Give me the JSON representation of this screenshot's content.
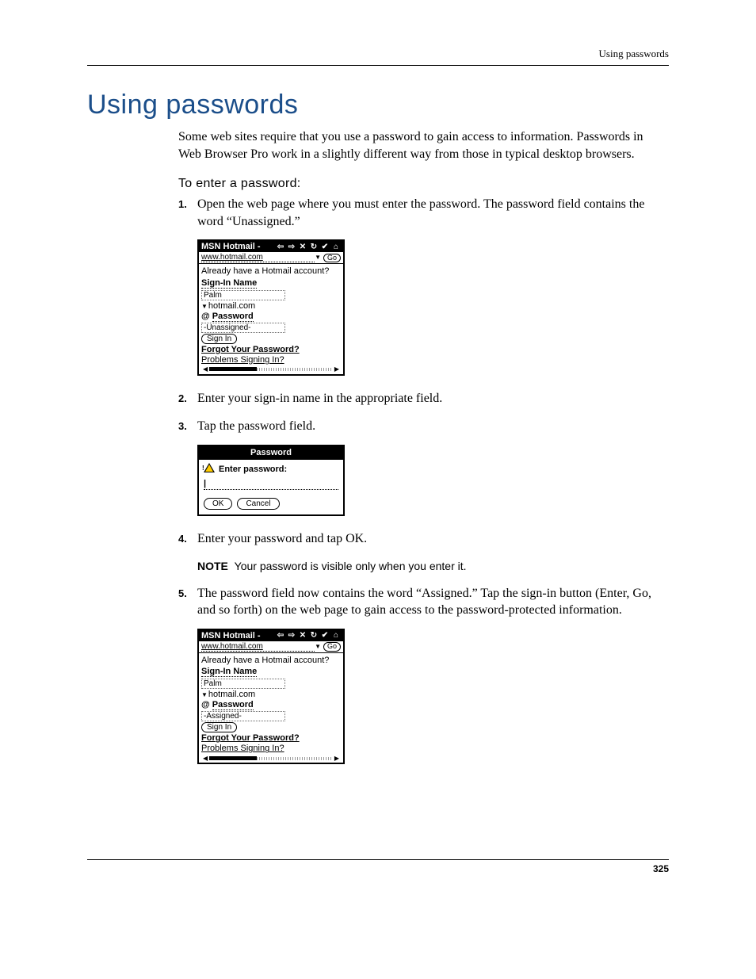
{
  "header": {
    "running": "Using passwords"
  },
  "title": "Using passwords",
  "intro": "Some web sites require that you use a password to gain access to information. Passwords in Web Browser Pro work in a slightly different way from those in typical desktop browsers.",
  "subhead": "To enter a password:",
  "steps": {
    "s1": "Open the web page where you must enter the password. The password field contains the word “Unassigned.”",
    "s2": "Enter your sign-in name in the appropriate field.",
    "s3": "Tap the password field.",
    "s4": "Enter your password and tap OK.",
    "s5": "The password field now contains the word “Assigned.” Tap the sign-in button (Enter, Go, and so forth) on the web page to gain access to the password-protected information."
  },
  "note": {
    "label": "NOTE",
    "text": "Your password is visible only when you enter it."
  },
  "fig_common": {
    "title": "MSN Hotmail -",
    "url": "www.hotmail.com",
    "go": "Go",
    "already": "Already have a Hotmail account?",
    "signin_label": "Sign-In Name",
    "signin_value": "Palm",
    "domain": "hotmail.com",
    "password_marker": "@",
    "password_label": "Password",
    "signin_btn": "Sign In",
    "forgot": "Forgot Your Password?",
    "problems": "Problems Signing In?"
  },
  "fig1": {
    "password_value": "-Unassigned-"
  },
  "fig2": {
    "title": "Password",
    "prompt": "Enter password:",
    "ok": "OK",
    "cancel": "Cancel",
    "cursor": "|"
  },
  "fig3": {
    "password_value": "-Assigned-"
  },
  "page_number": "325"
}
